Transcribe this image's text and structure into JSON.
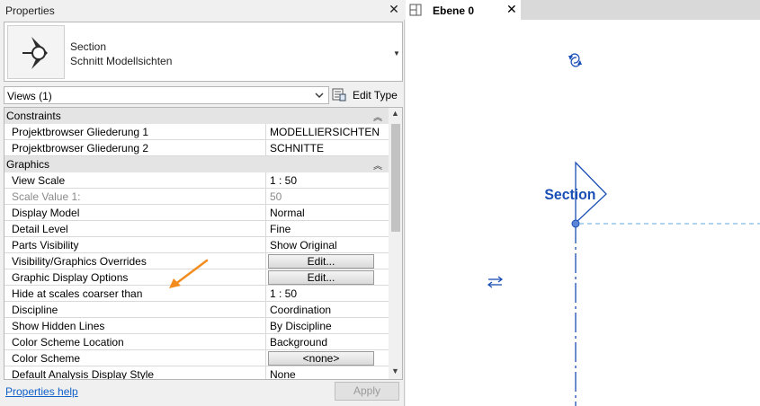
{
  "properties": {
    "title": "Properties",
    "type_selector": {
      "name": "Section",
      "subname": "Schnitt Modellsichten"
    },
    "filter": {
      "value": "Views (1)"
    },
    "edit_type_label": "Edit Type",
    "groups": [
      {
        "label": "Constraints",
        "rows": [
          {
            "name": "Projektbrowser Gliederung 1",
            "value": "MODELLIERSICHTEN"
          },
          {
            "name": "Projektbrowser Gliederung 2",
            "value": "SCHNITTE"
          }
        ]
      },
      {
        "label": "Graphics",
        "rows": [
          {
            "name": "View Scale",
            "value": "1 : 50"
          },
          {
            "name": "Scale Value    1:",
            "value": "50"
          },
          {
            "name": "Display Model",
            "value": "Normal"
          },
          {
            "name": "Detail Level",
            "value": "Fine"
          },
          {
            "name": "Parts Visibility",
            "value": "Show Original"
          },
          {
            "name": "Visibility/Graphics Overrides",
            "value": "Edit..."
          },
          {
            "name": "Graphic Display Options",
            "value": "Edit..."
          },
          {
            "name": "Hide at scales coarser than",
            "value": "1 : 50"
          },
          {
            "name": "Discipline",
            "value": "Coordination"
          },
          {
            "name": "Show Hidden Lines",
            "value": "By Discipline"
          },
          {
            "name": "Color Scheme Location",
            "value": "Background"
          },
          {
            "name": "Color Scheme",
            "value": "<none>"
          },
          {
            "name": "Default Analysis Display Style",
            "value": "None"
          }
        ]
      }
    ],
    "help_link": "Properties help",
    "apply_label": "Apply"
  },
  "view": {
    "tab_label": "Ebene 0",
    "section_label": "Section"
  },
  "colors": {
    "accent_blue": "#1a4fb5",
    "arrow_orange": "#f28c1e",
    "link_blue": "#1060c8"
  }
}
